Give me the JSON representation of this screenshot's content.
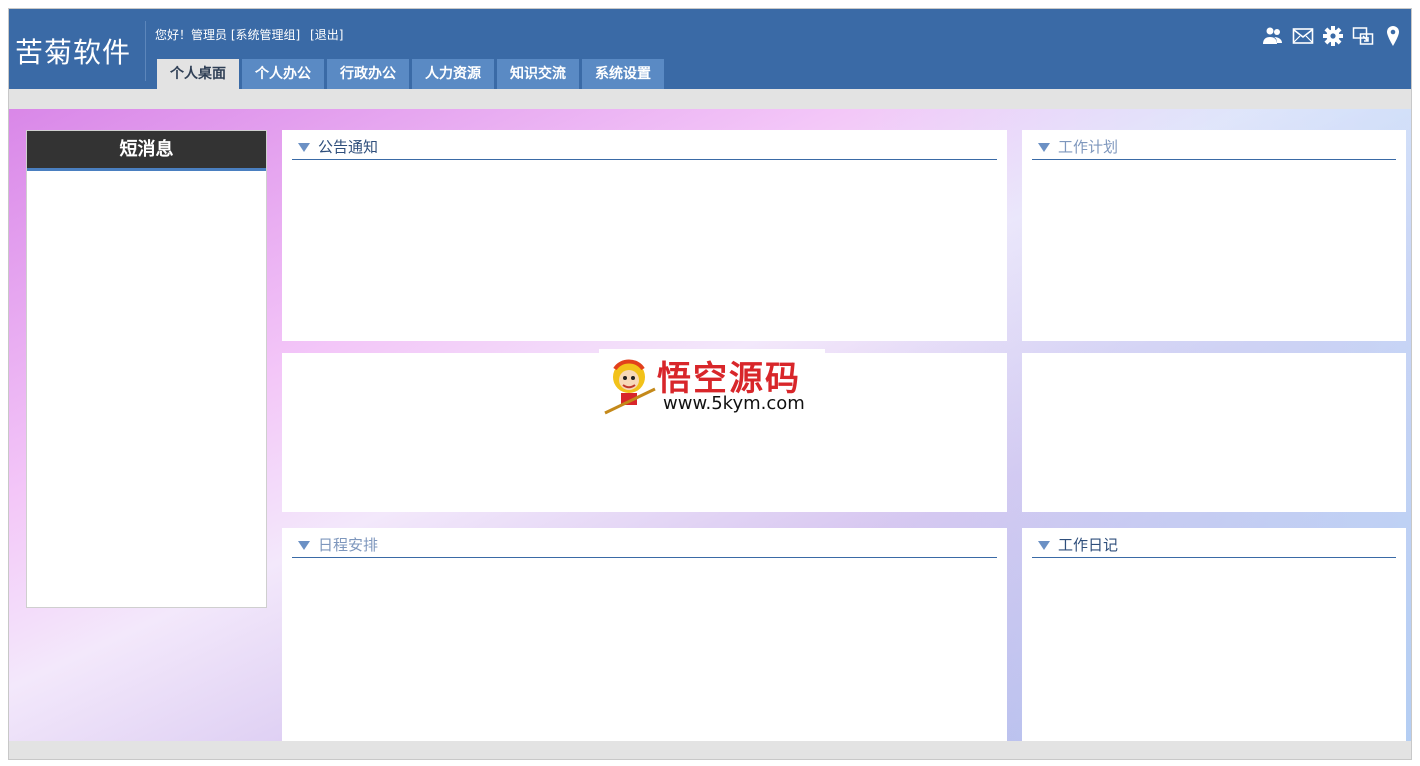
{
  "header": {
    "logo": "苦菊软件",
    "greeting": "您好！管理员 [系统管理组]",
    "logout": "[退出]",
    "tabs": [
      {
        "label": "个人桌面",
        "active": true
      },
      {
        "label": "个人办公",
        "active": false
      },
      {
        "label": "行政办公",
        "active": false
      },
      {
        "label": "人力资源",
        "active": false
      },
      {
        "label": "知识交流",
        "active": false
      },
      {
        "label": "系统设置",
        "active": false
      }
    ],
    "icons": [
      "users-icon",
      "mail-icon",
      "gear-icon",
      "window-switch-icon",
      "location-pin-icon"
    ]
  },
  "sidebar": {
    "title": "短消息"
  },
  "panels": {
    "notice": {
      "title": "公告通知"
    },
    "plan": {
      "title": "工作计划"
    },
    "schedule": {
      "title": "日程安排"
    },
    "diary": {
      "title": "工作日记"
    }
  },
  "watermark": {
    "text": "悟空源码",
    "url": "www.5kym.com"
  },
  "colors": {
    "header": "#3a6aa6",
    "tab": "#5a8ac4",
    "message_header": "#333333"
  }
}
